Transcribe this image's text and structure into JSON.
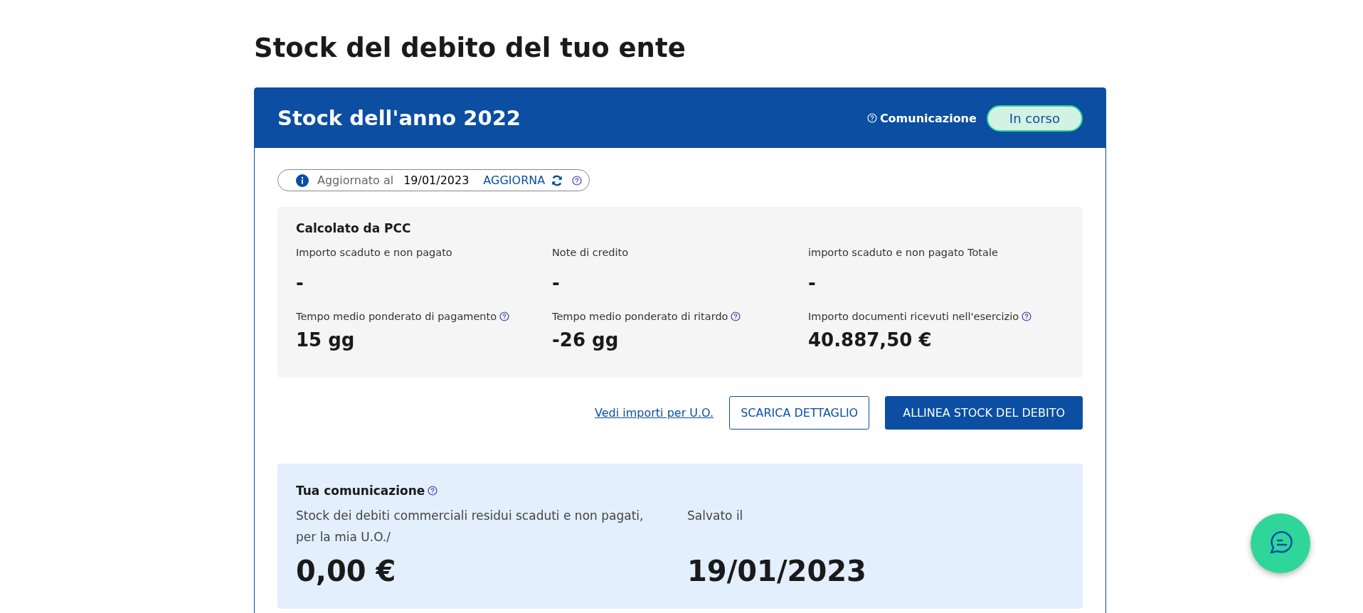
{
  "page_title": "Stock del debito del tuo ente",
  "card": {
    "title": "Stock dell'anno 2022",
    "help_link": "Comunicazione",
    "status": "In corso"
  },
  "update_bar": {
    "label": "Aggiornato al",
    "date": "19/01/2023",
    "action": "AGGIORNA"
  },
  "pcc": {
    "title": "Calcolato da PCC",
    "metrics": [
      {
        "label": "Importo scaduto e non pagato",
        "value": "-",
        "help": false
      },
      {
        "label": "Note di credito",
        "value": "-",
        "help": false
      },
      {
        "label": "importo scaduto e non pagato Totale",
        "value": "-",
        "help": false
      },
      {
        "label": "Tempo medio ponderato di pagamento",
        "value": "15 gg",
        "help": true
      },
      {
        "label": "Tempo medio ponderato di ritardo",
        "value": "-26 gg",
        "help": true
      },
      {
        "label": "Importo documenti ricevuti nell'esercizio",
        "value": "40.887,50 €",
        "help": true
      }
    ]
  },
  "actions": {
    "link": "Vedi importi per U.O.",
    "secondary": "SCARICA DETTAGLIO",
    "primary": "ALLINEA STOCK DEL DEBITO"
  },
  "communication": {
    "title": "Tua comunicazione",
    "fields": [
      {
        "label": "Stock dei debiti commerciali residui scaduti e non pagati, per la mia U.O./",
        "value": "0,00 €"
      },
      {
        "label": "Salvato il",
        "value": "19/01/2023"
      }
    ]
  }
}
